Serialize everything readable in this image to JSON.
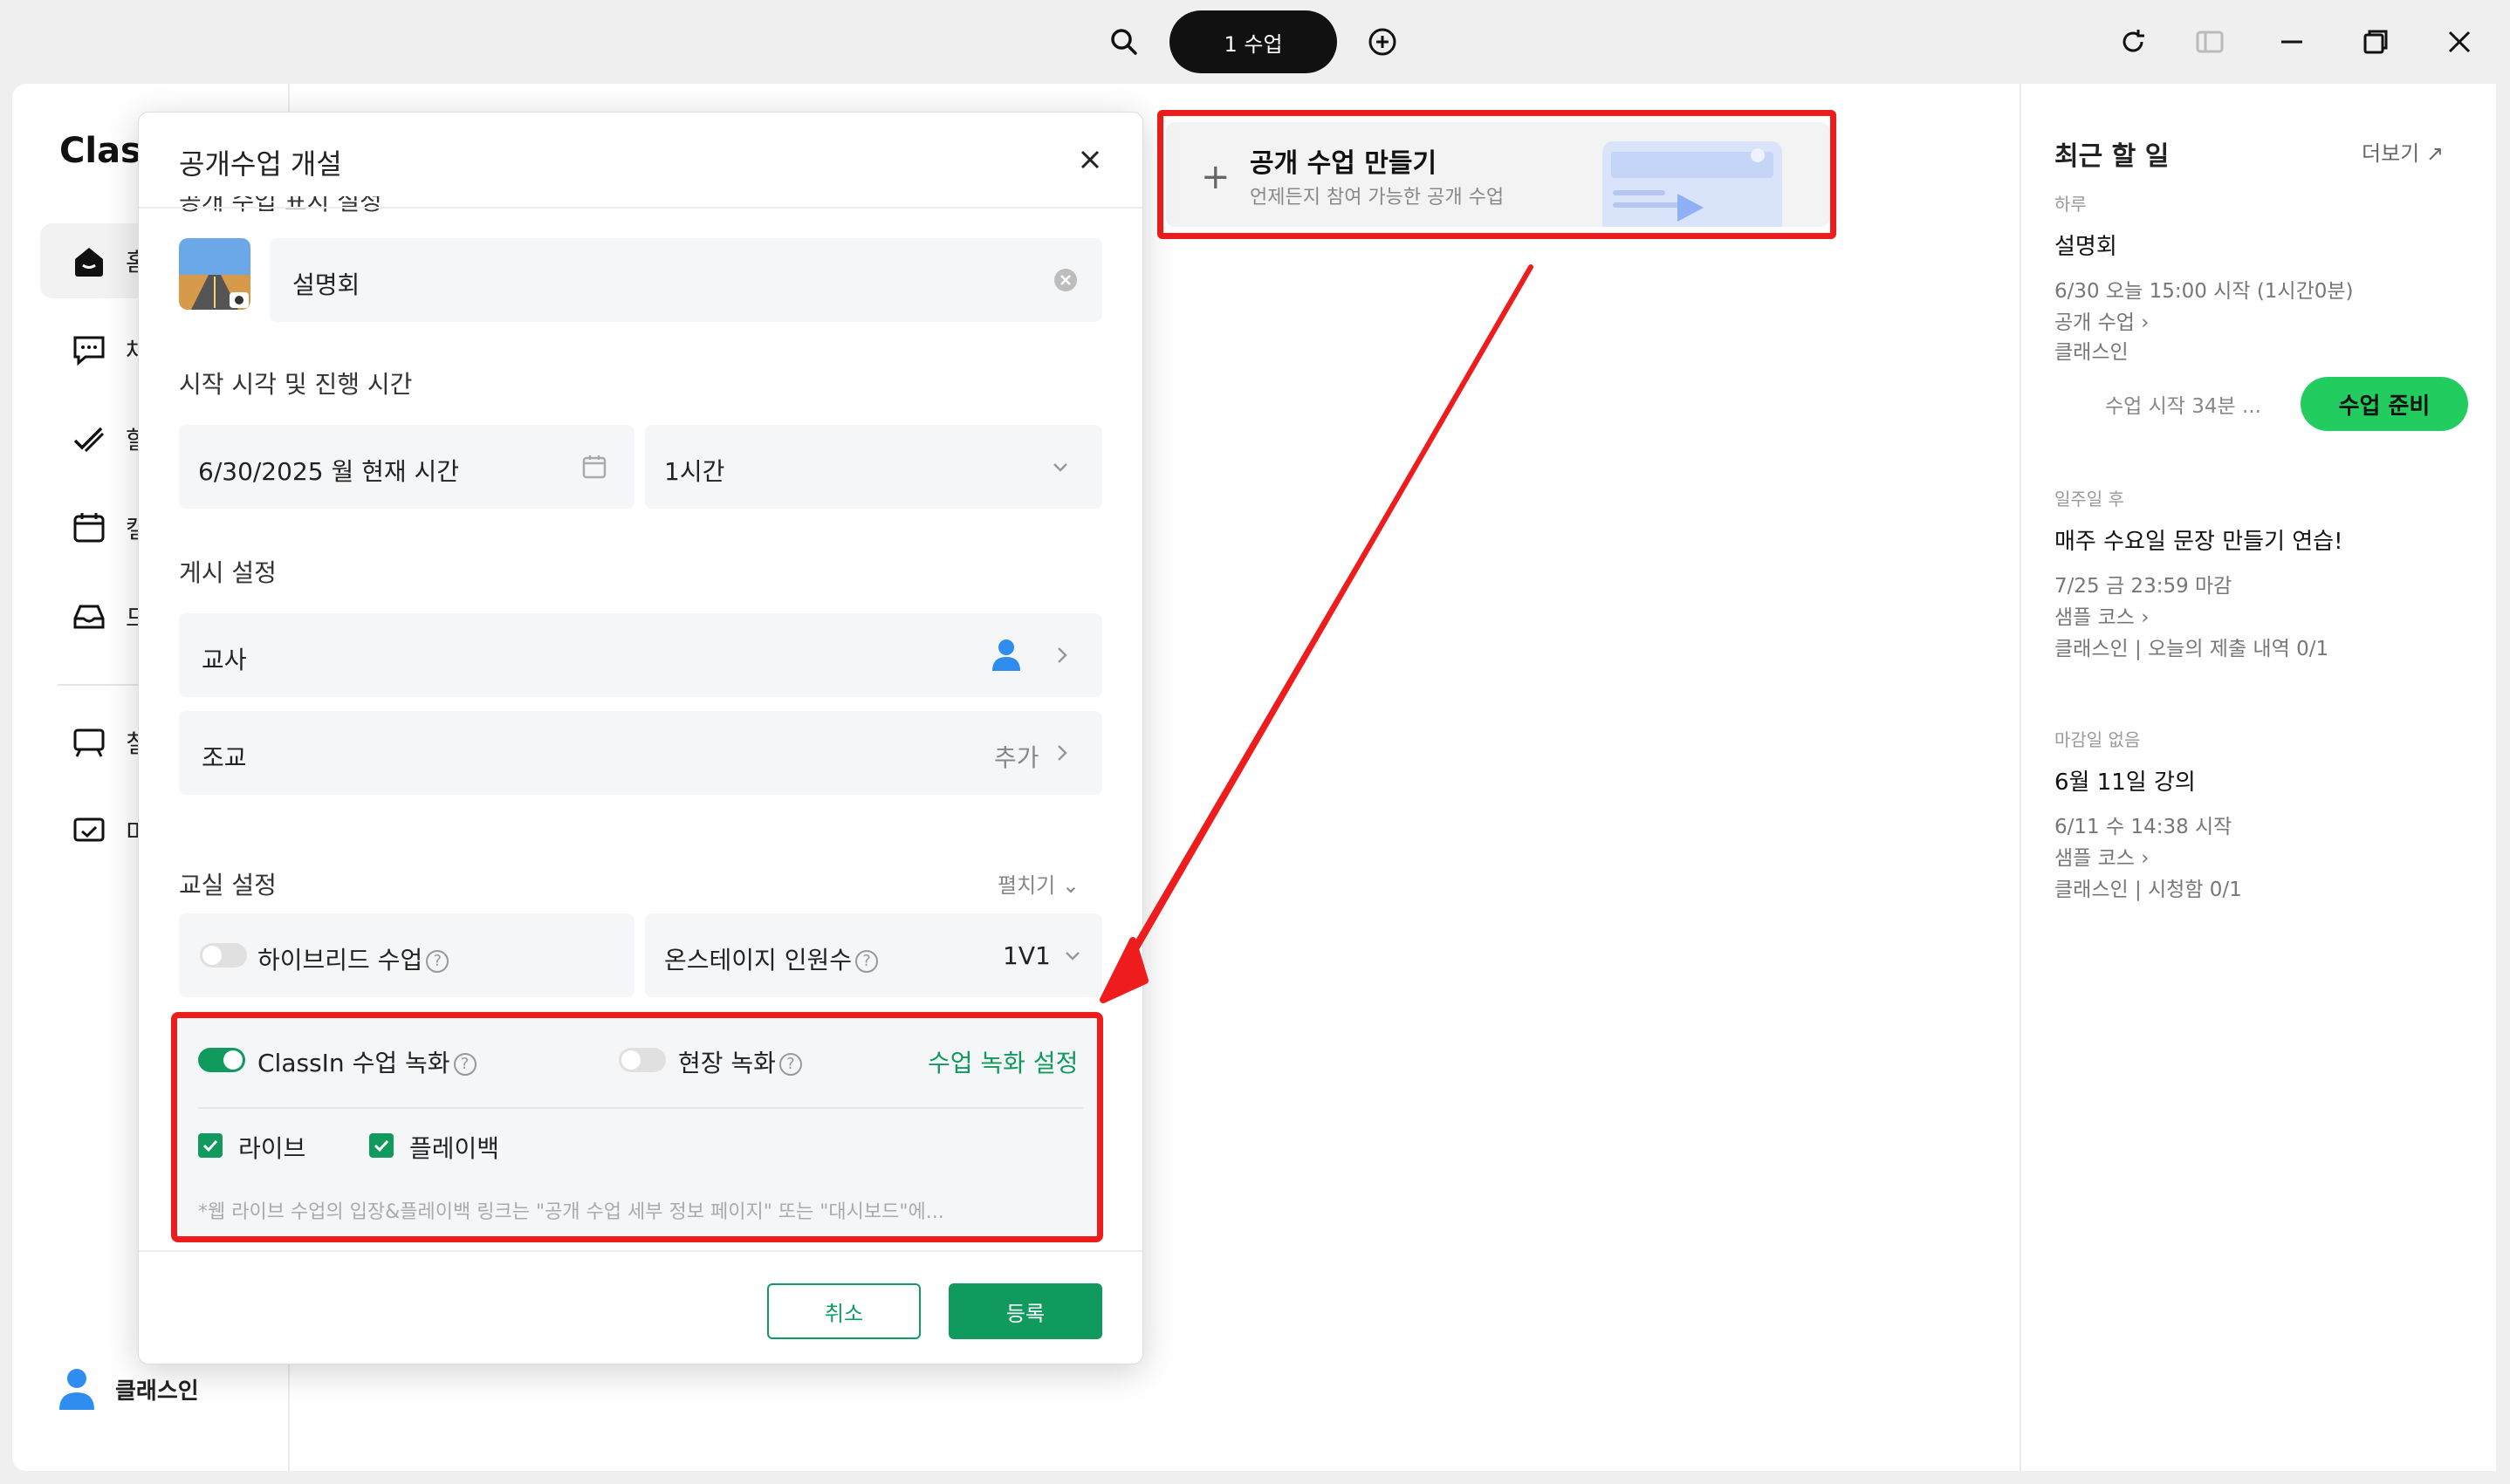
{
  "titlebar": {
    "lesson_pill": "1 수업"
  },
  "sidebar": {
    "logo": "Class",
    "items": [
      {
        "label": "홈",
        "icon": "home-icon"
      },
      {
        "label": "채",
        "icon": "chat-icon"
      },
      {
        "label": "할",
        "icon": "todo-icon"
      },
      {
        "label": "캘",
        "icon": "calendar-icon"
      },
      {
        "label": "드",
        "icon": "inbox-icon"
      },
      {
        "label": "칠",
        "icon": "blackboard-icon"
      },
      {
        "label": "미",
        "icon": "media-icon"
      }
    ],
    "user_name": "클래스인"
  },
  "create_card": {
    "title": "공개 수업 만들기",
    "subtitle": "언제든지 참여 가능한 공개 수업"
  },
  "right_panel": {
    "title": "최근 할 일",
    "more": "더보기",
    "groups": [
      {
        "group": "하루",
        "name": "설명회",
        "lines": [
          "6/30 오늘 15:00 시작 (1시간0분)",
          "공개 수업 ›",
          "클래스인"
        ],
        "wait": "수업 시작 34분 ...",
        "button": "수업 준비"
      },
      {
        "group": "일주일 후",
        "name": "매주 수요일 문장 만들기 연습!",
        "lines": [
          "7/25 금 23:59 마감",
          "샘플 코스 ›",
          "클래스인 | 오늘의 제출 내역 0/1"
        ]
      },
      {
        "group": "마감일 없음",
        "name": "6월 11일 강의",
        "lines": [
          "6/11 수 14:38 시작",
          "샘플 코스 ›",
          "클래스인 | 시청함 0/1"
        ]
      }
    ]
  },
  "dialog": {
    "title": "공개수업 개설",
    "cut_label": "공개 수업 표지 설정",
    "name_value": "설명회",
    "time_label": "시작 시각 및 진행 시간",
    "date_value": "6/30/2025 월 현재 시간",
    "duration_value": "1시간",
    "post_label": "게시 설정",
    "teacher_label": "교사",
    "assistant_label": "조교",
    "assistant_add": "추가",
    "classroom_label": "교실 설정",
    "expand_label": "펼치기",
    "hybrid_label": "하이브리드 수업",
    "onstage_label": "온스테이지 인원수",
    "onstage_value": "1V1",
    "classin_rec_label": "ClassIn 수업 녹화",
    "onsite_rec_label": "현장 녹화",
    "rec_settings_link": "수업 녹화 설정",
    "live_label": "라이브",
    "playback_label": "플레이백",
    "hint": "*웹 라이브 수업의 입장&플레이백 링크는 \"공개 수업 세부 정보 페이지\" 또는 \"대시보드\"에...",
    "cancel_label": "취소",
    "submit_label": "등록"
  },
  "colors": {
    "accent_green": "#119a5e",
    "cta_green": "#22cc5e",
    "annotation_red": "#ee1c1c"
  }
}
